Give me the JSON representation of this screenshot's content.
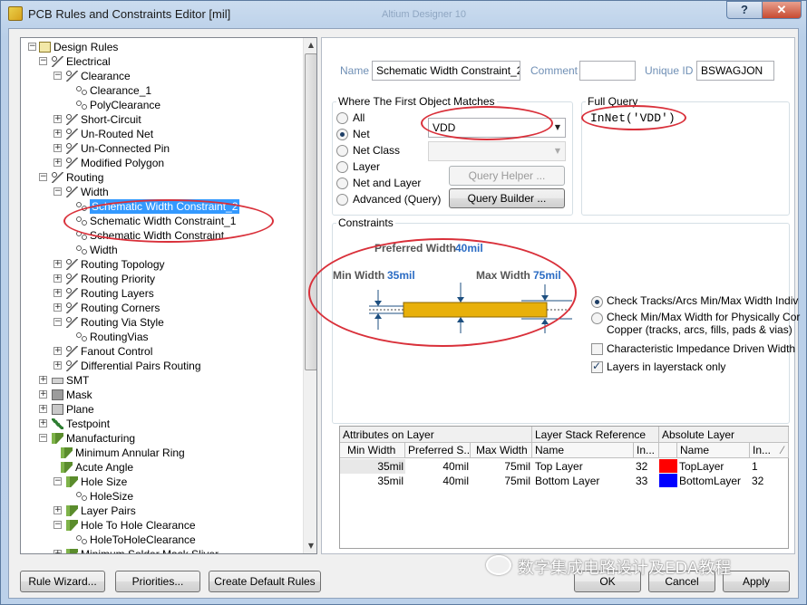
{
  "window": {
    "title": "PCB Rules and Constraints Editor [mil]",
    "ghost_title": "Altium Designer 10",
    "help_label": "?",
    "close_label": "✕"
  },
  "tree": {
    "root": "Design Rules",
    "items": [
      {
        "label": "Electrical"
      },
      {
        "label": "Clearance"
      },
      {
        "label": "Clearance_1"
      },
      {
        "label": "PolyClearance"
      },
      {
        "label": "Short-Circuit"
      },
      {
        "label": "Un-Routed Net"
      },
      {
        "label": "Un-Connected Pin"
      },
      {
        "label": "Modified Polygon"
      },
      {
        "label": "Routing"
      },
      {
        "label": "Width"
      },
      {
        "label": "Schematic Width Constraint_2"
      },
      {
        "label": "Schematic Width Constraint_1"
      },
      {
        "label": "Schematic Width Constraint"
      },
      {
        "label": "Width"
      },
      {
        "label": "Routing Topology"
      },
      {
        "label": "Routing Priority"
      },
      {
        "label": "Routing Layers"
      },
      {
        "label": "Routing Corners"
      },
      {
        "label": "Routing Via Style"
      },
      {
        "label": "RoutingVias"
      },
      {
        "label": "Fanout Control"
      },
      {
        "label": "Differential Pairs Routing"
      },
      {
        "label": "SMT"
      },
      {
        "label": "Mask"
      },
      {
        "label": "Plane"
      },
      {
        "label": "Testpoint"
      },
      {
        "label": "Manufacturing"
      },
      {
        "label": "Minimum Annular Ring"
      },
      {
        "label": "Acute Angle"
      },
      {
        "label": "Hole Size"
      },
      {
        "label": "HoleSize"
      },
      {
        "label": "Layer Pairs"
      },
      {
        "label": "Hole To Hole Clearance"
      },
      {
        "label": "HoleToHoleClearance"
      },
      {
        "label": "Minimum Solder Mask Sliver"
      }
    ]
  },
  "rule": {
    "name_label": "Name",
    "name_value": "Schematic Width Constraint_2",
    "comment_label": "Comment",
    "comment_value": "",
    "uid_label": "Unique ID",
    "uid_value": "BSWAGJON"
  },
  "match": {
    "title": "Where The First Object Matches",
    "options": [
      "All",
      "Net",
      "Net Class",
      "Layer",
      "Net and Layer",
      "Advanced (Query)"
    ],
    "selected": "Net",
    "net_value": "VDD",
    "net_class_value": "",
    "query_helper_label": "Query Helper ...",
    "query_builder_label": "Query Builder ..."
  },
  "full_query": {
    "title": "Full Query",
    "text": "InNet('VDD')"
  },
  "constraints": {
    "title": "Constraints",
    "preferred_label": "Preferred Width",
    "preferred_value": "40mil",
    "min_label": "Min Width",
    "min_value": "35mil",
    "max_label": "Max Width",
    "max_value": "75mil",
    "options": [
      {
        "label": "Check Tracks/Arcs Min/Max Width Indiv",
        "checked": true
      },
      {
        "label": "Check Min/Max Width for Physically Cor",
        "sub": "Copper (tracks, arcs, fills, pads & vias)",
        "checked": false
      }
    ],
    "checks": [
      {
        "label": "Characteristic Impedance Driven Width",
        "checked": false
      },
      {
        "label": "Layers in layerstack only",
        "checked": true
      }
    ]
  },
  "table": {
    "group_headers": [
      "Attributes on Layer",
      "Layer Stack Reference",
      "Absolute Layer"
    ],
    "columns": [
      "Min Width",
      "Preferred S...",
      "Max Width",
      "Name",
      "In...",
      "",
      "Name",
      "In..."
    ],
    "rows": [
      {
        "min": "35mil",
        "pref": "40mil",
        "max": "75mil",
        "stack_name": "Top Layer",
        "stack_index": "32",
        "color": "#ff0000",
        "abs_name": "TopLayer",
        "abs_index": "1"
      },
      {
        "min": "35mil",
        "pref": "40mil",
        "max": "75mil",
        "stack_name": "Bottom Layer",
        "stack_index": "33",
        "color": "#0000ff",
        "abs_name": "BottomLayer",
        "abs_index": "32"
      }
    ]
  },
  "footer": {
    "rule_wizard": "Rule Wizard...",
    "priorities": "Priorities...",
    "create_default": "Create Default Rules",
    "ok": "OK",
    "cancel": "Cancel",
    "apply": "Apply"
  },
  "watermark": "数字集成电路设计及EDA教程",
  "colors": {
    "selection": "#3399ff",
    "track": "#e8b00a",
    "annotation": "#d9303a",
    "width_value": "#2b6cc4"
  }
}
